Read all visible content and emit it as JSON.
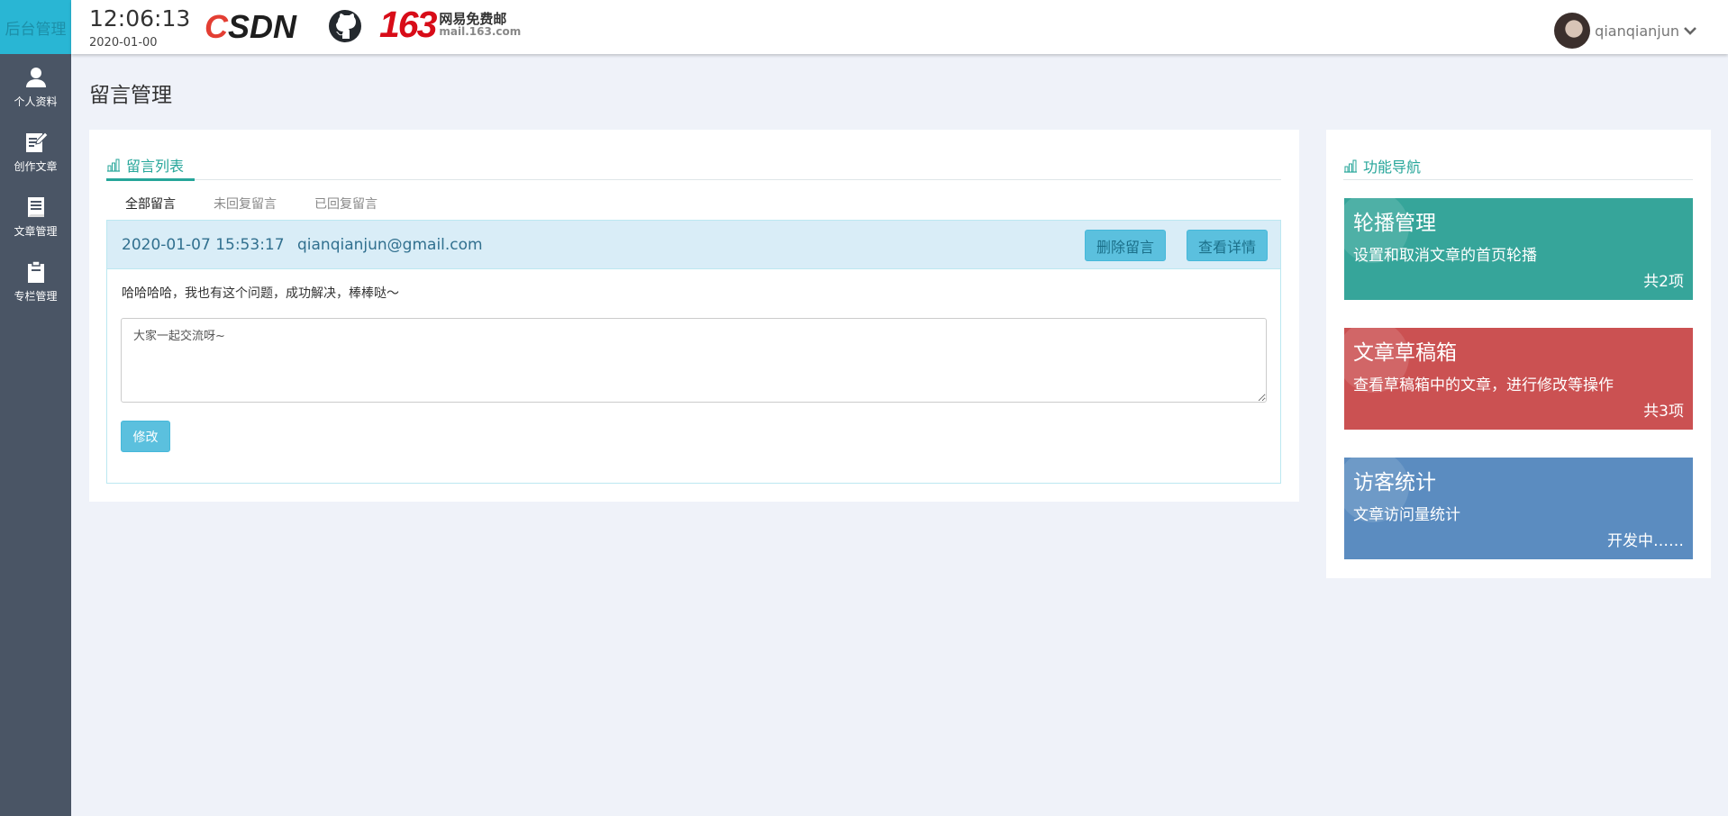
{
  "sidebar": {
    "brand": "后台管理",
    "items": [
      {
        "label": "个人资料",
        "icon": "user-icon"
      },
      {
        "label": "创作文章",
        "icon": "edit-icon"
      },
      {
        "label": "文章管理",
        "icon": "document-icon"
      },
      {
        "label": "专栏管理",
        "icon": "clipboard-icon"
      }
    ]
  },
  "header": {
    "time": "12:06:13",
    "date": "2020-01-00",
    "logos": {
      "csdn_c": "C",
      "csdn_rest": "SDN",
      "mail_num": "163",
      "mail_cn": "网易免费邮",
      "mail_en": "mail.163.com"
    },
    "username": "qianqianjun"
  },
  "page": {
    "title": "留言管理"
  },
  "messages_panel": {
    "title": "留言列表",
    "tabs": [
      "全部留言",
      "未回复留言",
      "已回复留言"
    ],
    "message": {
      "datetime": "2020-01-07 15:53:17",
      "email": "qianqianjun@gmail.com",
      "delete_label": "删除留言",
      "view_label": "查看详情",
      "content": "哈哈哈哈，我也有这个问题，成功解决，棒棒哒～",
      "reply": "大家一起交流呀~",
      "edit_label": "修改"
    }
  },
  "nav_panel": {
    "title": "功能导航",
    "cards": [
      {
        "title": "轮播管理",
        "desc": "设置和取消文章的首页轮播",
        "count": "共2项",
        "color": "#36a59a"
      },
      {
        "title": "文章草稿箱",
        "desc": "查看草稿箱中的文章，进行修改等操作",
        "count": "共3项",
        "color": "#cb5152"
      },
      {
        "title": "访客统计",
        "desc": "文章访问量统计",
        "count": "开发中……",
        "color": "#5b8cc0"
      }
    ]
  },
  "colors": {
    "sidebar": "#4a5565",
    "brand": "#29b6d4",
    "accent": "#26a69a",
    "info": "#5bc0de"
  }
}
